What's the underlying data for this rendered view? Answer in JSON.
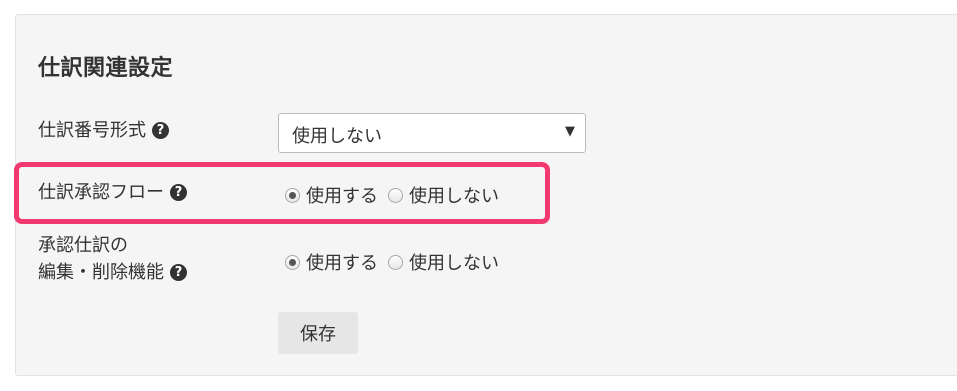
{
  "section": {
    "title": "仕訳関連設定"
  },
  "fields": {
    "journal_number_format": {
      "label": "仕訳番号形式",
      "value": "使用しない"
    },
    "approval_flow": {
      "label": "仕訳承認フロー",
      "options": [
        "使用する",
        "使用しない"
      ],
      "selected": "使用する"
    },
    "approved_edit_delete": {
      "label_line1": "承認仕訳の",
      "label_line2": "編集・削除機能",
      "options": [
        "使用する",
        "使用しない"
      ],
      "selected": "使用する"
    }
  },
  "actions": {
    "save_label": "保存"
  },
  "icons": {
    "help": "question-circle-icon",
    "dropdown": "caret-down-icon"
  },
  "colors": {
    "highlight": "#f2396f",
    "panel_bg": "#f5f5f5"
  }
}
